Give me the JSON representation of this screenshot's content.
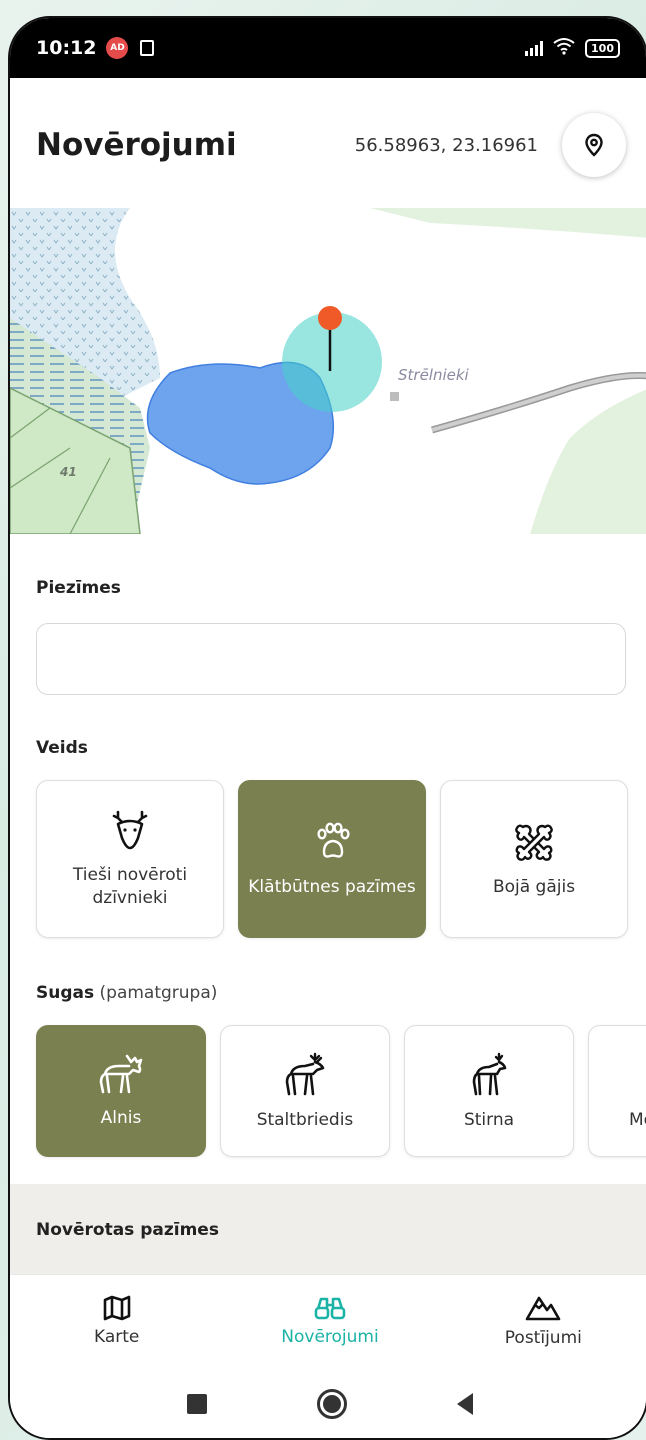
{
  "status_bar": {
    "time": "10:12",
    "ad_badge": "AD",
    "battery": "100"
  },
  "header": {
    "title": "Novērojumi",
    "coords": "56.58963, 23.16961"
  },
  "map": {
    "place_label": "Strēlnieki",
    "parcel_number": "41"
  },
  "notes": {
    "label": "Piezīmes",
    "value": ""
  },
  "type_section": {
    "label": "Veids",
    "options": [
      {
        "label": "Tieši novēroti dzīvnieki",
        "icon": "deer-head-icon",
        "selected": false
      },
      {
        "label": "Klātbūtnes pazīmes",
        "icon": "paw-icon",
        "selected": true
      },
      {
        "label": "Bojā gājis",
        "icon": "bone-icon",
        "selected": false
      }
    ]
  },
  "species_section": {
    "label": "Sugas",
    "sublabel": "(pamatgrupa)",
    "options": [
      {
        "label": "Alnis",
        "icon": "moose-icon",
        "selected": true
      },
      {
        "label": "Staltbriedis",
        "icon": "red-deer-icon",
        "selected": false
      },
      {
        "label": "Stirna",
        "icon": "roe-deer-icon",
        "selected": false
      },
      {
        "label": "Me",
        "icon": "animal-icon",
        "selected": false
      }
    ]
  },
  "observed_signs": {
    "label": "Novērotas pazīmes"
  },
  "bottom_nav": [
    {
      "label": "Karte",
      "icon": "map-icon",
      "active": false
    },
    {
      "label": "Novērojumi",
      "icon": "binoculars-icon",
      "active": true
    },
    {
      "label": "Postījumi",
      "icon": "mountains-icon",
      "active": false
    }
  ],
  "colors": {
    "accent_olive": "#7a8050",
    "accent_teal": "#1bb3a6",
    "pin_orange": "#f05a28"
  }
}
